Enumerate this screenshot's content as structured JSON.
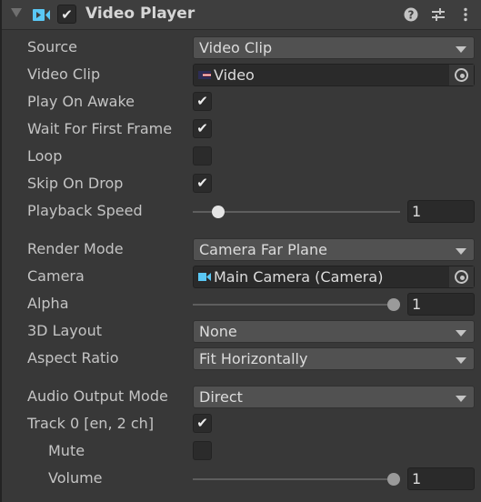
{
  "header": {
    "title": "Video Player",
    "enabled": true,
    "icons": [
      "video-player-icon",
      "help-icon",
      "presets-icon",
      "more-options-icon"
    ]
  },
  "colors": {
    "accent": "#5ac8f5",
    "background": "#383838",
    "field": "#2a2a2a",
    "dropdown": "#515151"
  },
  "sections": [
    [
      {
        "type": "dropdown",
        "label": "Source",
        "value": "Video Clip"
      },
      {
        "type": "object",
        "label": "Video Clip",
        "value": "Video",
        "icon": "video-clip-icon"
      },
      {
        "type": "checkbox",
        "label": "Play On Awake",
        "checked": true
      },
      {
        "type": "checkbox",
        "label": "Wait For First Frame",
        "checked": true
      },
      {
        "type": "checkbox",
        "label": "Loop",
        "checked": false
      },
      {
        "type": "checkbox",
        "label": "Skip On Drop",
        "checked": true
      },
      {
        "type": "slider",
        "label": "Playback Speed",
        "value": "1",
        "min": 0,
        "max": 10
      }
    ],
    [
      {
        "type": "dropdown",
        "label": "Render Mode",
        "value": "Camera Far Plane"
      },
      {
        "type": "object",
        "label": "Camera",
        "value": "Main Camera (Camera)",
        "icon": "camera-icon"
      },
      {
        "type": "slider",
        "label": "Alpha",
        "value": "1",
        "min": 0,
        "max": 1
      },
      {
        "type": "dropdown",
        "label": "3D Layout",
        "value": "None"
      },
      {
        "type": "dropdown",
        "label": "Aspect Ratio",
        "value": "Fit Horizontally"
      }
    ],
    [
      {
        "type": "dropdown",
        "label": "Audio Output Mode",
        "value": "Direct"
      },
      {
        "type": "checkbox",
        "label": "Track 0 [en, 2 ch]",
        "checked": true
      },
      {
        "type": "checkbox",
        "label": "Mute",
        "checked": false,
        "indent": true
      },
      {
        "type": "slider",
        "label": "Volume",
        "value": "1",
        "min": 0,
        "max": 1,
        "indent": true
      }
    ]
  ]
}
